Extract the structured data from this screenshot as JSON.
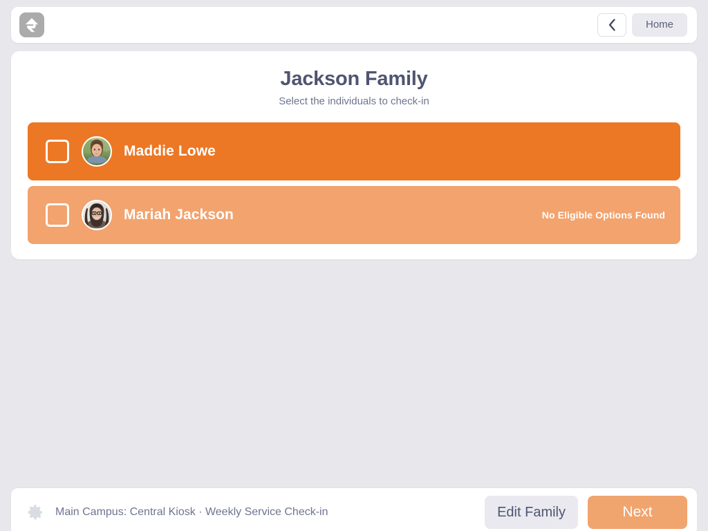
{
  "theme": {
    "page_bg": "#e7e7ec",
    "card_bg": "#ffffff",
    "accent_orange": "#ec7725",
    "accent_orange_muted": "#f2a36e",
    "primary_button": "#f0a46e",
    "text_dark": "#4f5570",
    "text_muted": "#6f7490",
    "logo_gray": "#ababab"
  },
  "header": {
    "logo_icon": "rock-rms-arrow-logo",
    "back_icon": "chevron-left-icon",
    "back_label": "",
    "home_label": "Home"
  },
  "main": {
    "title": "Jackson Family",
    "subtitle": "Select the individuals to check-in",
    "people": [
      {
        "name": "Maddie Lowe",
        "note": "",
        "checked": false,
        "state": "available",
        "avatar_alt": "child-avatar-photo"
      },
      {
        "name": "Mariah Jackson",
        "note": "No Eligible Options Found",
        "checked": false,
        "state": "ineligible",
        "avatar_alt": "adult-avatar-photo"
      }
    ]
  },
  "footer": {
    "gear_icon": "gear-icon",
    "info": "Main Campus: Central Kiosk · Weekly Service Check-in",
    "edit_family_label": "Edit Family",
    "next_label": "Next"
  }
}
